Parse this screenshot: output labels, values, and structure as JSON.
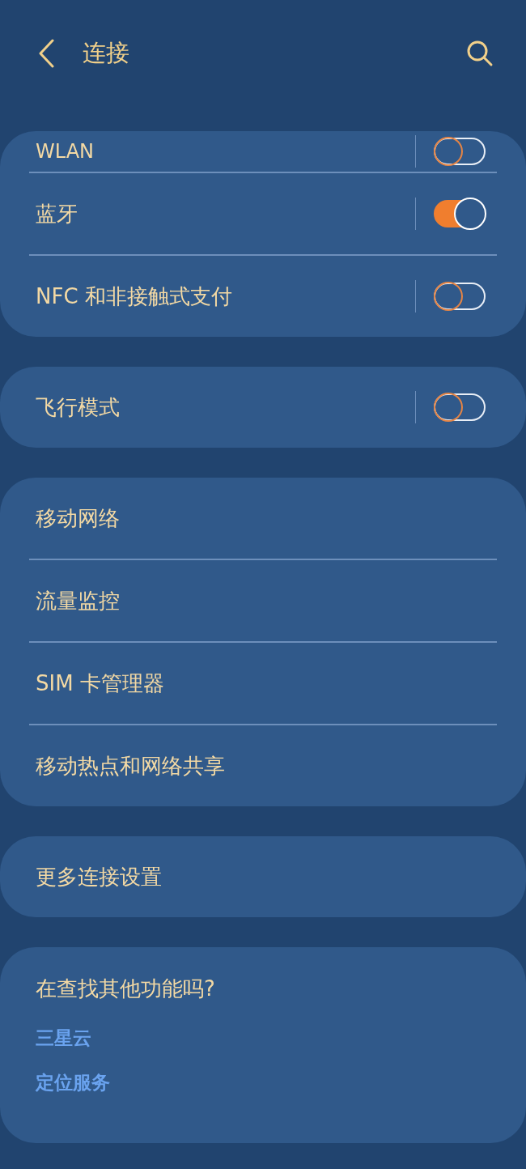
{
  "header": {
    "title": "连接"
  },
  "sections": [
    {
      "kind": "list",
      "items": [
        {
          "kind": "switch",
          "label": "WLAN",
          "on": false,
          "clipped": true
        },
        {
          "kind": "switch",
          "label": "蓝牙",
          "on": true
        },
        {
          "kind": "switch",
          "label": "NFC 和非接触式支付",
          "on": false
        }
      ]
    },
    {
      "kind": "list",
      "items": [
        {
          "kind": "switch",
          "label": "飞行模式",
          "on": false
        }
      ]
    },
    {
      "kind": "list",
      "items": [
        {
          "kind": "link",
          "label": "移动网络"
        },
        {
          "kind": "link",
          "label": "流量监控"
        },
        {
          "kind": "link",
          "label": "SIM 卡管理器"
        },
        {
          "kind": "link",
          "label": "移动热点和网络共享"
        }
      ]
    },
    {
      "kind": "list",
      "items": [
        {
          "kind": "link",
          "label": "更多连接设置"
        }
      ]
    },
    {
      "kind": "suggestions",
      "title": "在查找其他功能吗?",
      "links": [
        "三星云",
        "定位服务"
      ]
    }
  ]
}
